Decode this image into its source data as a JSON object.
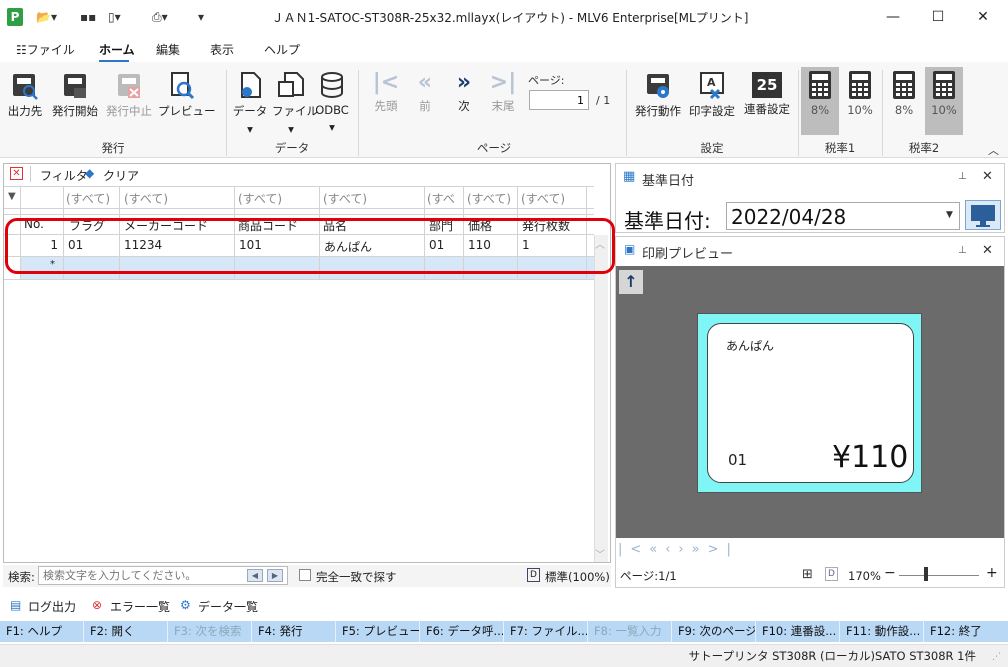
{
  "window": {
    "title": "ＪＡＮ1-SATOC-ST308R-25x32.mllayx(レイアウト) - MLV6 Enterprise[MLプリント]",
    "app_letter": "P"
  },
  "menu": {
    "file": "ファイル",
    "home": "ホーム",
    "edit": "編集",
    "view": "表示",
    "help": "ヘルプ"
  },
  "ribbon": {
    "output_dest": "出力先",
    "issue_start": "発行開始",
    "issue_stop": "発行中止",
    "preview": "プレビュー",
    "group_issue": "発行",
    "data": "データ",
    "file": "ファイル",
    "odbc": "ODBC",
    "group_data": "データ",
    "first": "先頭",
    "prev": "前",
    "next": "次",
    "last": "末尾",
    "page_label": "ページ:",
    "page_value": "1",
    "page_total": "/ 1",
    "group_page": "ページ",
    "issue_action": "発行動作",
    "print_setting": "印字設定",
    "serial_setting": "連番設定",
    "group_setting": "設定",
    "serial_icon": "25",
    "tax1_a": "8%",
    "tax1_b": "10%",
    "group_tax1": "税率1",
    "tax2_a": "8%",
    "tax2_b": "10%",
    "group_tax2": "税率2"
  },
  "grid_toolbar": {
    "filter": "フィルタ",
    "clear": "クリア"
  },
  "grid": {
    "filter_text": "(すべて)",
    "filter_short": "(すべ",
    "headers": [
      "No.",
      "フラグ",
      "メーカーコード",
      "商品コード",
      "品名",
      "部門",
      "価格",
      "発行枚数"
    ],
    "rows": [
      [
        "1",
        "01",
        "11234",
        "101",
        "あんぱん",
        "01",
        "110",
        "1"
      ]
    ],
    "new_row_marker": "*"
  },
  "search": {
    "label": "検索:",
    "placeholder": "検索文字を入力してください。",
    "exact_match": "完全一致で探す",
    "view_mode": "標準(100%)"
  },
  "base_date_panel": {
    "title": "基準日付",
    "label": "基準日付:",
    "value": "2022/04/28"
  },
  "preview_panel": {
    "title": "印刷プレビュー",
    "label_product": "あんぱん",
    "label_dept": "01",
    "label_price": "¥110",
    "page_info": "ページ:1/1",
    "zoom": "170%"
  },
  "bottom_tabs": {
    "log": "ログ出力",
    "errors": "エラー一覧",
    "data_list": "データ一覧"
  },
  "fkeys": [
    {
      "label": "F1: ヘルプ",
      "enabled": true
    },
    {
      "label": "F2: 開く",
      "enabled": true
    },
    {
      "label": "F3: 次を検索",
      "enabled": false
    },
    {
      "label": "F4: 発行",
      "enabled": true
    },
    {
      "label": "F5: プレビュー",
      "enabled": true
    },
    {
      "label": "F6: データ呼...",
      "enabled": true
    },
    {
      "label": "F7: ファイル...",
      "enabled": true
    },
    {
      "label": "F8: 一覧入力",
      "enabled": false
    },
    {
      "label": "F9: 次のページ",
      "enabled": true
    },
    {
      "label": "F10: 連番設...",
      "enabled": true
    },
    {
      "label": "F11: 動作設...",
      "enabled": true
    },
    {
      "label": "F12: 終了",
      "enabled": true
    }
  ],
  "status": {
    "printer": "サトープリンタ  ST308R  (ローカル)SATO ST308R  1件"
  },
  "colors": {
    "accent": "#2b77c9",
    "fkey_bar": "#b9d8f5",
    "label_bg": "#7ff5f5",
    "highlight": "#e0000a",
    "preview_bg": "#6b6b6b"
  }
}
